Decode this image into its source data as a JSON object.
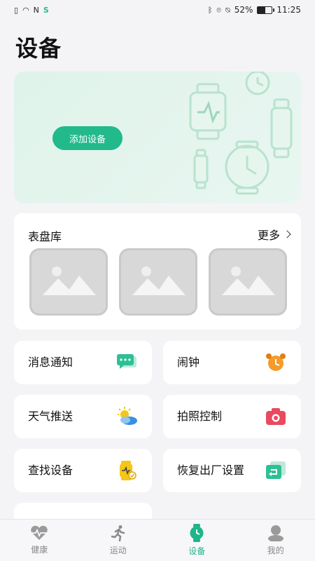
{
  "status": {
    "battery": "52%",
    "battery_level": 0.52,
    "time": "11:25"
  },
  "page": {
    "title": "设备"
  },
  "banner": {
    "add_button": "添加设备"
  },
  "watch_faces": {
    "title": "表盘库",
    "more": "更多"
  },
  "features": [
    {
      "label": "消息通知",
      "icon": "message-icon"
    },
    {
      "label": "闹钟",
      "icon": "alarm-clock-icon"
    },
    {
      "label": "天气推送",
      "icon": "weather-icon"
    },
    {
      "label": "拍照控制",
      "icon": "camera-icon"
    },
    {
      "label": "查找设备",
      "icon": "find-device-icon"
    },
    {
      "label": "恢复出厂设置",
      "icon": "factory-reset-icon"
    }
  ],
  "nav": [
    {
      "label": "健康",
      "icon": "heart-icon"
    },
    {
      "label": "运动",
      "icon": "running-icon"
    },
    {
      "label": "设备",
      "icon": "watch-icon"
    },
    {
      "label": "我的",
      "icon": "profile-icon"
    }
  ],
  "colors": {
    "accent": "#1fb58a",
    "alarm": "#f59b2b",
    "camera": "#e84a5f",
    "find": "#f5c518"
  }
}
